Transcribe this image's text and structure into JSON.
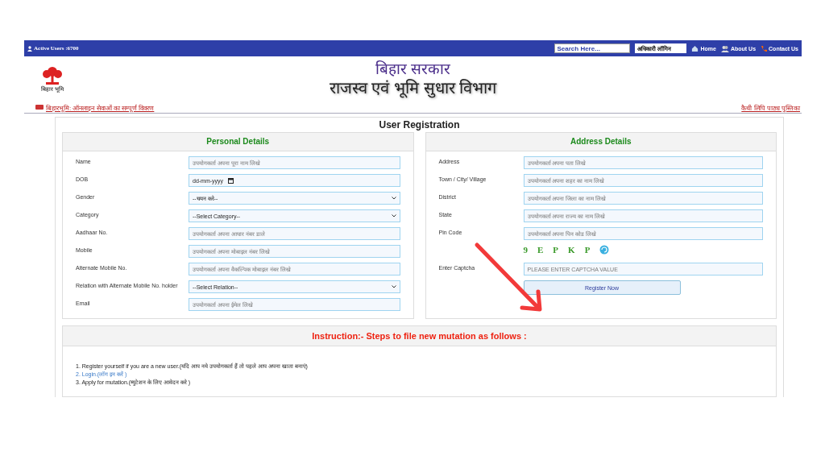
{
  "top_bar": {
    "active_users": "Active Users :6700",
    "search": {
      "placeholder": "Search Here..."
    },
    "login_select": "अधिकारी लॉगिन",
    "nav": [
      {
        "label": "Home",
        "kind": "home"
      },
      {
        "label": "About Us",
        "kind": "about"
      },
      {
        "label": "Contact Us",
        "kind": "contact"
      }
    ]
  },
  "header": {
    "logo_caption": "बिहार भूमि",
    "title": "बिहार सरकार",
    "subtitle": "राजस्व एवं भूमि सुधार विभाग",
    "left_link": "बिहारभूमि: ऑनलाइन सेवाओं का सम्पूर्ण विवरण",
    "right_link": "कैथी लिपि पाठ्य पुस्तिका"
  },
  "form": {
    "title": "User Registration",
    "panels": [
      {
        "title": "Personal Details",
        "fields": [
          {
            "label": "Name",
            "kind": "text",
            "placeholder": "उपयोगकर्ता अपना पूरा नाम लिखे"
          },
          {
            "label": "DOB",
            "kind": "date",
            "value": "dd-mm-yyyy"
          },
          {
            "label": "Gender",
            "kind": "select",
            "value": "--चयन करे--"
          },
          {
            "label": "Category",
            "kind": "select",
            "value": "--Select Category--"
          },
          {
            "label": "Aadhaar No.",
            "kind": "text",
            "placeholder": "उपयोगकर्ता अपना आधार नंबर डाले"
          },
          {
            "label": "Mobile",
            "kind": "text",
            "placeholder": "उपयोगकर्ता अपना मोबाइल नंबर लिखे"
          },
          {
            "label": "Alternate Mobile No.",
            "kind": "text",
            "placeholder": "उपयोगकर्ता अपना वैकल्पिक मोबाइल नंबर लिखे"
          },
          {
            "label": "Relation with Alternate Mobile No. holder",
            "kind": "select",
            "value": "--Select Relation--"
          },
          {
            "label": "Email",
            "kind": "text",
            "placeholder": "उपयोगकर्ता अपना ईमेल लिखे"
          }
        ]
      },
      {
        "title": "Address Details",
        "fields": [
          {
            "label": "Address",
            "kind": "text",
            "placeholder": "उपयोगकर्ता अपना पता लिखे"
          },
          {
            "label": "Town / City/ Village",
            "kind": "text",
            "placeholder": "उपयोगकर्ता अपना शहर का नाम लिखे"
          },
          {
            "label": "District",
            "kind": "text",
            "placeholder": "उपयोगकर्ता अपना जिला का नाम लिखे"
          },
          {
            "label": "State",
            "kind": "text",
            "placeholder": "उपयोगकर्ता अपना राज्य का नाम लिखे"
          },
          {
            "label": "Pin Code",
            "kind": "text",
            "placeholder": "उपयोगकर्ता अपना पिन कोड लिखे"
          },
          {
            "kind": "captcha",
            "chars": [
              "9",
              "E",
              "P",
              "K",
              "P"
            ]
          },
          {
            "label": "Enter Captcha",
            "kind": "text",
            "placeholder": "PLEASE ENTER CAPTCHA VALUE"
          }
        ],
        "button": "Register Now"
      }
    ]
  },
  "instructions": {
    "title": "Instruction:- Steps to file new mutation as follows :",
    "steps": [
      {
        "text": "1. Register yourself if you are a new user.(यदि आप नये उपयोगकर्ता हैं तो पहले आप अपना खाता बनाएं)",
        "kind": "text"
      },
      {
        "text": "2. Login.(लॉग इन करें )",
        "kind": "link"
      },
      {
        "text": "3. Apply for mutation.(म्युटेशन के लिए आवेदन करे )",
        "kind": "text"
      }
    ]
  }
}
